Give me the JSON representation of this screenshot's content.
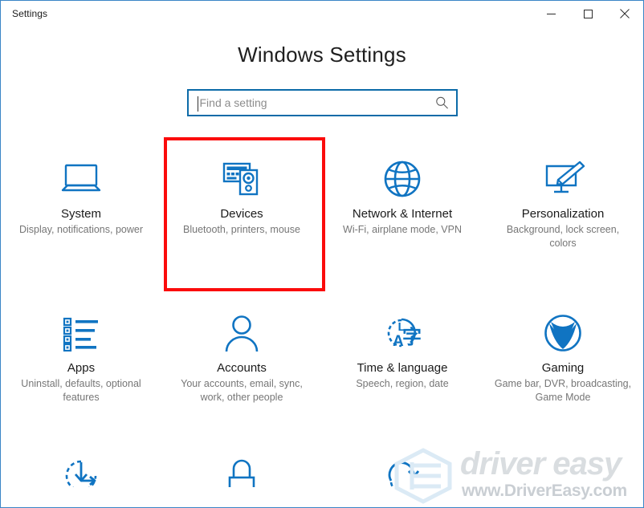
{
  "window": {
    "title": "Settings",
    "border_color": "#3b86c6",
    "caption_buttons": [
      {
        "name": "minimize",
        "glyph": "minimize-icon",
        "label": "Minimize"
      },
      {
        "name": "maximize",
        "glyph": "maximize-icon",
        "label": "Maximize"
      },
      {
        "name": "close",
        "glyph": "close-icon",
        "label": "Close"
      }
    ]
  },
  "header": {
    "title": "Windows Settings"
  },
  "search": {
    "placeholder": "Find a setting",
    "value": "",
    "icon": "search-icon",
    "border_color": "#0c6ba8",
    "focused": true
  },
  "highlight": {
    "target": "Devices",
    "color": "#fb0b0b",
    "border_width": 4
  },
  "theme": {
    "icon_blue": "#1074c2",
    "title_text": "#1b1b1b",
    "desc_text": "#767676"
  },
  "tiles": [
    {
      "id": "system",
      "icon": "laptop-icon",
      "title": "System",
      "desc": "Display, notifications, power"
    },
    {
      "id": "devices",
      "icon": "keyboard-speaker-icon",
      "title": "Devices",
      "desc": "Bluetooth, printers, mouse"
    },
    {
      "id": "network",
      "icon": "globe-icon",
      "title": "Network & Internet",
      "desc": "Wi-Fi, airplane mode, VPN"
    },
    {
      "id": "personalization",
      "icon": "monitor-paintbrush-icon",
      "title": "Personalization",
      "desc": "Background, lock screen, colors"
    },
    {
      "id": "apps",
      "icon": "bullet-list-icon",
      "title": "Apps",
      "desc": "Uninstall, defaults, optional features"
    },
    {
      "id": "accounts",
      "icon": "person-icon",
      "title": "Accounts",
      "desc": "Your accounts, email, sync, work, other people"
    },
    {
      "id": "time-language",
      "icon": "clock-language-icon",
      "title": "Time & language",
      "desc": "Speech, region, date"
    },
    {
      "id": "gaming",
      "icon": "xbox-icon",
      "title": "Gaming",
      "desc": "Game bar, DVR, broadcasting, Game Mode"
    }
  ],
  "tiles_partial": [
    {
      "id": "update-security",
      "icon": "sync-download-icon",
      "title": "",
      "desc": ""
    },
    {
      "id": "privacy",
      "icon": "lock-icon",
      "title": "",
      "desc": ""
    },
    {
      "id": "ease-of-access",
      "icon": "refresh-arrow-icon",
      "title": "",
      "desc": ""
    },
    {
      "id": "placeholder",
      "icon": "blank-icon",
      "title": "",
      "desc": ""
    }
  ],
  "watermark": {
    "brand": "driver easy",
    "url": "www.DriverEasy.com",
    "logo": "hexagon-logo-icon"
  }
}
